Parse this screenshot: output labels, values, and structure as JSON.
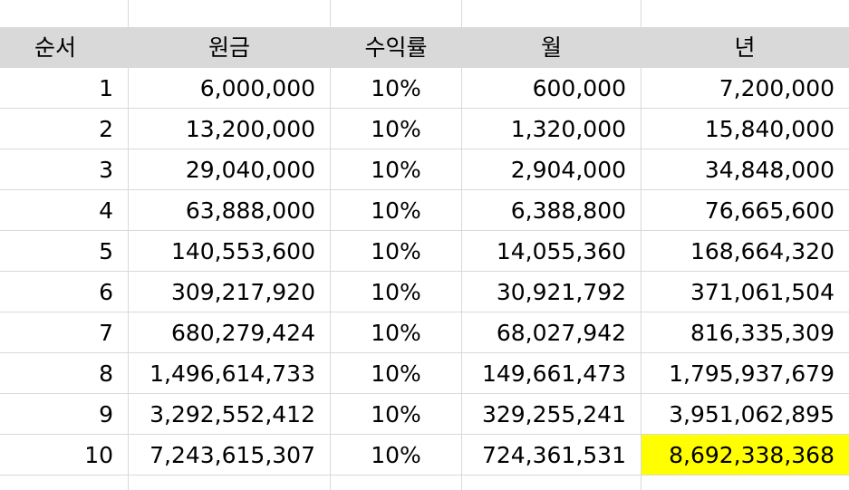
{
  "sheet": {
    "headers": [
      "순서",
      "원금",
      "수익률",
      "월",
      "년"
    ],
    "rows": [
      [
        "1",
        "6,000,000",
        "10%",
        "600,000",
        "7,200,000"
      ],
      [
        "2",
        "13,200,000",
        "10%",
        "1,320,000",
        "15,840,000"
      ],
      [
        "3",
        "29,040,000",
        "10%",
        "2,904,000",
        "34,848,000"
      ],
      [
        "4",
        "63,888,000",
        "10%",
        "6,388,800",
        "76,665,600"
      ],
      [
        "5",
        "140,553,600",
        "10%",
        "14,055,360",
        "168,664,320"
      ],
      [
        "6",
        "309,217,920",
        "10%",
        "30,921,792",
        "371,061,504"
      ],
      [
        "7",
        "680,279,424",
        "10%",
        "68,027,942",
        "816,335,309"
      ],
      [
        "8",
        "1,496,614,733",
        "10%",
        "149,661,473",
        "1,795,937,679"
      ],
      [
        "9",
        "3,292,552,412",
        "10%",
        "329,255,241",
        "3,951,062,895"
      ],
      [
        "10",
        "7,243,615,307",
        "10%",
        "724,361,531",
        "8,692,338,368"
      ]
    ],
    "header_fill_color": "#d9d9d9",
    "highlight_color": "#ffff00"
  }
}
